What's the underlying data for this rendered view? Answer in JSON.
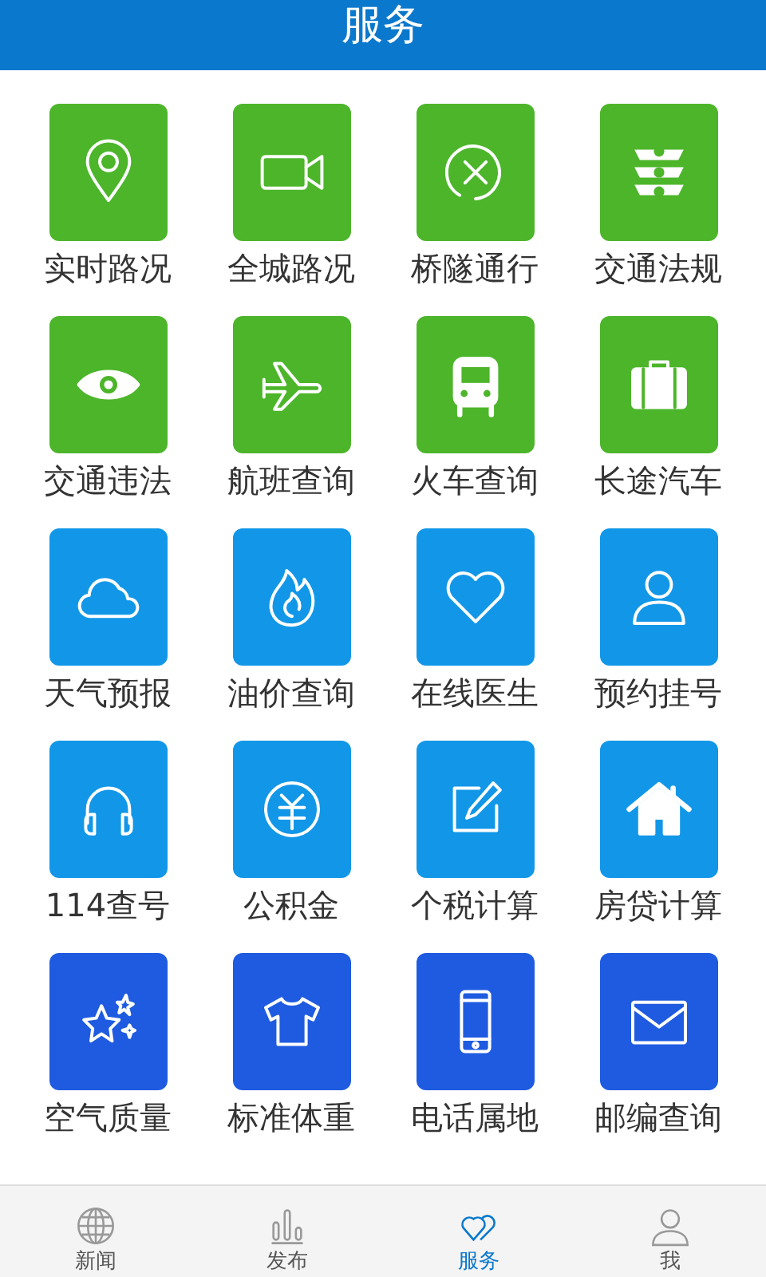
{
  "header": {
    "title": "服务"
  },
  "services": [
    {
      "label": "实时路况",
      "color": "#4cb52a"
    },
    {
      "label": "全城路况",
      "color": "#4cb52a"
    },
    {
      "label": "桥隧通行",
      "color": "#4cb52a"
    },
    {
      "label": "交通法规",
      "color": "#4cb52a"
    },
    {
      "label": "交通违法",
      "color": "#4cb52a"
    },
    {
      "label": "航班查询",
      "color": "#4cb52a"
    },
    {
      "label": "火车查询",
      "color": "#4cb52a"
    },
    {
      "label": "长途汽车",
      "color": "#4cb52a"
    },
    {
      "label": "天气预报",
      "color": "#1297e8"
    },
    {
      "label": "油价查询",
      "color": "#1297e8"
    },
    {
      "label": "在线医生",
      "color": "#1297e8"
    },
    {
      "label": "预约挂号",
      "color": "#1297e8"
    },
    {
      "label": "114查号",
      "color": "#1297e8"
    },
    {
      "label": "公积金",
      "color": "#1297e8"
    },
    {
      "label": "个税计算",
      "color": "#1297e8"
    },
    {
      "label": "房贷计算",
      "color": "#1297e8"
    },
    {
      "label": "空气质量",
      "color": "#1e5be0"
    },
    {
      "label": "标准体重",
      "color": "#1e5be0"
    },
    {
      "label": "电话属地",
      "color": "#1e5be0"
    },
    {
      "label": "邮编查询",
      "color": "#1e5be0"
    }
  ],
  "tab_bar": [
    {
      "label": "新闻",
      "selected": false
    },
    {
      "label": "发布",
      "selected": false
    },
    {
      "label": "服务",
      "selected": true
    },
    {
      "label": "我",
      "selected": false
    }
  ]
}
